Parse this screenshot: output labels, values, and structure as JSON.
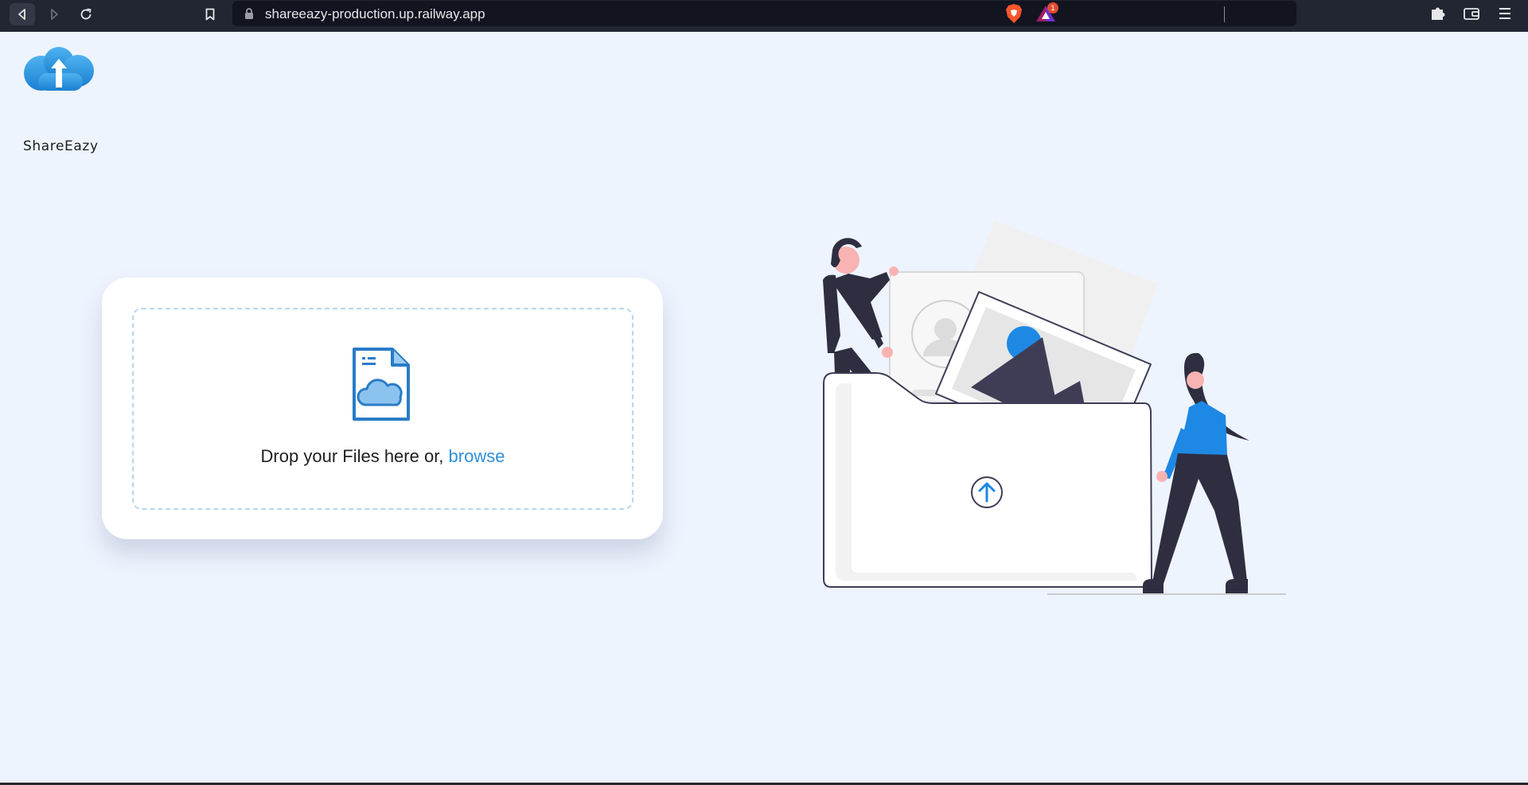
{
  "browser": {
    "url": "shareeazy-production.up.railway.app",
    "rewards_badge_count": "1",
    "icons": {
      "back": "back-icon",
      "forward": "forward-icon",
      "reload": "reload-icon",
      "bookmark": "bookmark-icon",
      "lock": "lock-icon",
      "brave_shields": "brave-shield-icon",
      "brave_rewards": "brave-rewards-icon",
      "extensions": "puzzle-icon",
      "wallet": "wallet-icon",
      "menu": "hamburger-menu-icon"
    }
  },
  "app": {
    "logo_text": "ShareEazy",
    "brand_color": "#2f8fdd"
  },
  "upload": {
    "drop_text": "Drop your Files here or, ",
    "browse_label": "browse",
    "icon": "file-cloud-icon"
  },
  "illustration": {
    "icon": "upload-folder-illustration",
    "accent_color": "#1e88e5"
  },
  "colors": {
    "page_bg": "#eef4fe",
    "card_bg": "#ffffff",
    "dropzone_border": "#b7d7ef",
    "link": "#2f8fdd"
  }
}
